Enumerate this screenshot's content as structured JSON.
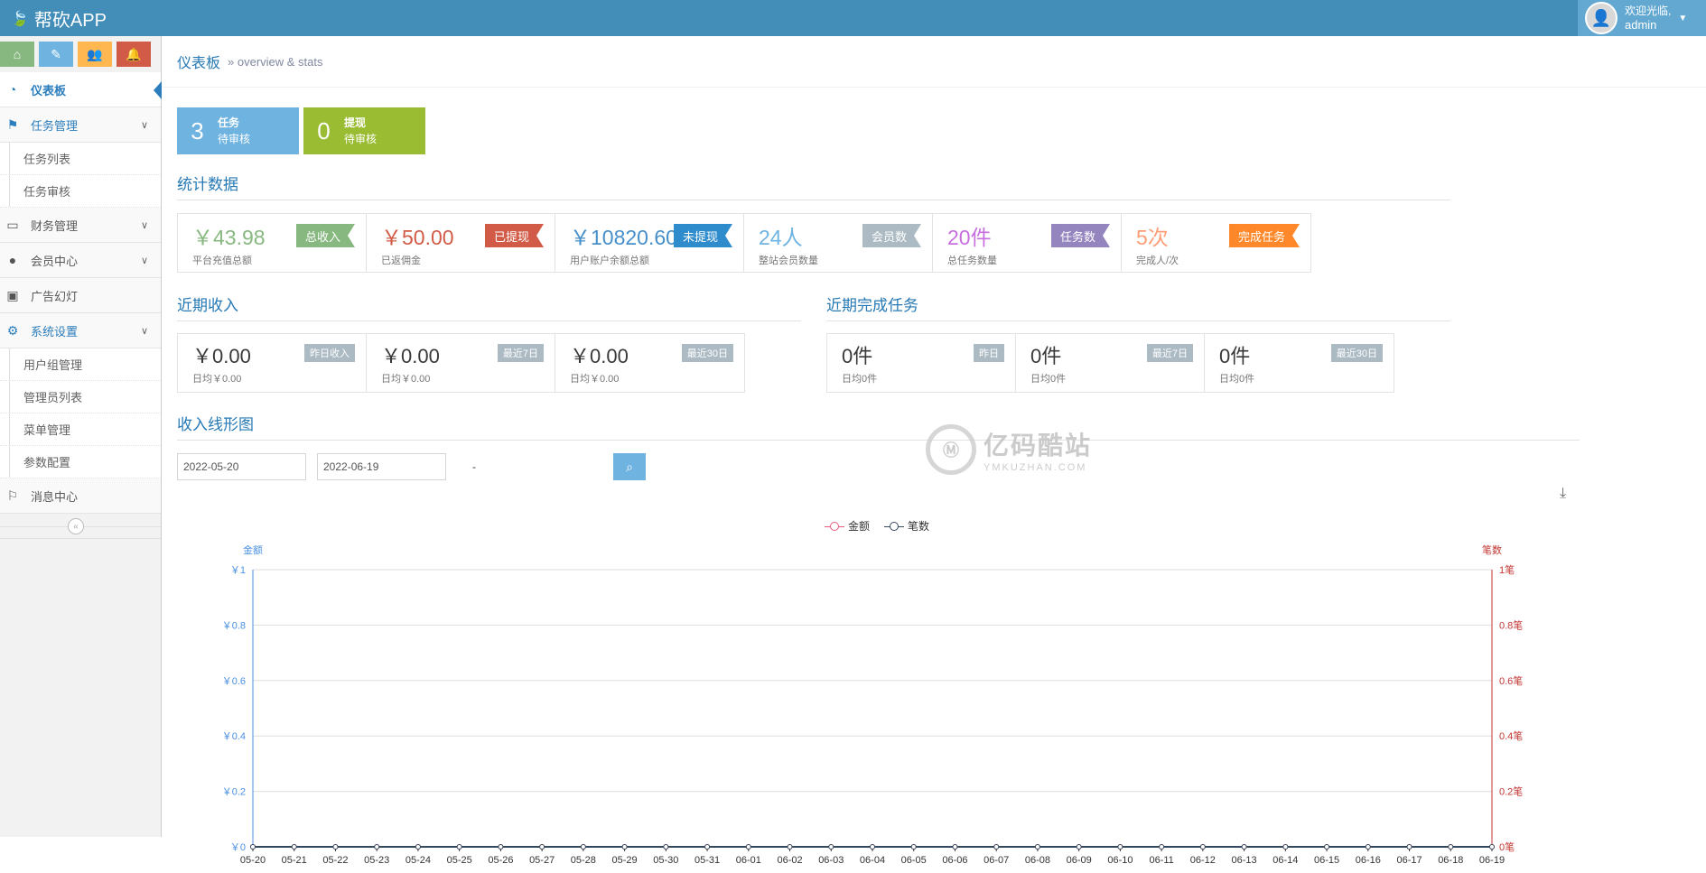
{
  "app": {
    "name": "帮砍APP"
  },
  "user": {
    "greeting": "欢迎光临,",
    "name": "admin"
  },
  "shortcuts": [
    "home-icon",
    "pencil-icon",
    "users-icon",
    "bell-icon"
  ],
  "sidebar": {
    "items": [
      {
        "label": "仪表板",
        "icon": "dashboard-icon"
      },
      {
        "label": "任务管理",
        "icon": "flag-icon"
      },
      {
        "label": "任务列表"
      },
      {
        "label": "任务审核"
      },
      {
        "label": "财务管理",
        "icon": "hdd-icon"
      },
      {
        "label": "会员中心",
        "icon": "user-icon"
      },
      {
        "label": "广告幻灯",
        "icon": "picture-icon"
      },
      {
        "label": "系统设置",
        "icon": "cog-icon"
      },
      {
        "label": "用户组管理"
      },
      {
        "label": "管理员列表"
      },
      {
        "label": "菜单管理"
      },
      {
        "label": "参数配置"
      },
      {
        "label": "消息中心",
        "icon": "bookmark-icon"
      }
    ]
  },
  "breadcrumb": {
    "title": "仪表板",
    "subtitle": "overview & stats"
  },
  "pending": [
    {
      "num": "3",
      "title": "任务",
      "sub": "待审核",
      "color": "#6fb3e0"
    },
    {
      "num": "0",
      "title": "提现",
      "sub": "待审核",
      "color": "#9abc32"
    }
  ],
  "stats_title": "统计数据",
  "stats": [
    {
      "value": "￥43.98",
      "label": "平台充值总额",
      "tag": "总收入",
      "color": "#87b87f",
      "tagColor": "#87b87f"
    },
    {
      "value": "￥50.00",
      "label": "已返佣金",
      "tag": "已提现",
      "color": "#d15b47",
      "tagColor": "#d15b47"
    },
    {
      "value": "￥10820.60",
      "label": "用户账户余额总额",
      "tag": "未提现",
      "color": "#478fca",
      "tagColor": "#2e8bcc"
    },
    {
      "value": "24人",
      "label": "整站会员数量",
      "tag": "会员数",
      "color": "#6fb3e0",
      "tagColor": "#abbac3"
    },
    {
      "value": "20件",
      "label": "总任务数量",
      "tag": "任务数",
      "color": "#c86fe0",
      "tagColor": "#9585bf"
    },
    {
      "value": "5次",
      "label": "完成人/次",
      "tag": "完成任务",
      "color": "#fe9e76",
      "tagColor": "#ff892a"
    }
  ],
  "income_title": "近期收入",
  "income": [
    {
      "value": "￥0.00",
      "sub": "日均￥0.00",
      "tag": "昨日收入"
    },
    {
      "value": "￥0.00",
      "sub": "日均￥0.00",
      "tag": "最近7日"
    },
    {
      "value": "￥0.00",
      "sub": "日均￥0.00",
      "tag": "最近30日"
    }
  ],
  "tasks_title": "近期完成任务",
  "tasks": [
    {
      "value": "0件",
      "sub": "日均0件",
      "tag": "昨日"
    },
    {
      "value": "0件",
      "sub": "日均0件",
      "tag": "最近7日"
    },
    {
      "value": "0件",
      "sub": "日均0件",
      "tag": "最近30日"
    }
  ],
  "chart_section_title": "收入线形图",
  "date_from": "2022-05-20",
  "date_to": "2022-06-19",
  "date_sep": "-",
  "watermark": {
    "main": "亿码酷站",
    "sub": "YMKUZHAN.COM"
  },
  "chart_data": {
    "type": "line",
    "categories": [
      "05-20",
      "05-21",
      "05-22",
      "05-23",
      "05-24",
      "05-25",
      "05-26",
      "05-27",
      "05-28",
      "05-29",
      "05-30",
      "05-31",
      "06-01",
      "06-02",
      "06-03",
      "06-04",
      "06-05",
      "06-06",
      "06-07",
      "06-08",
      "06-09",
      "06-10",
      "06-11",
      "06-12",
      "06-13",
      "06-14",
      "06-15",
      "06-16",
      "06-17",
      "06-18",
      "06-19"
    ],
    "series": [
      {
        "name": "金额",
        "color": "#e75c7c",
        "axis": "left",
        "values": [
          0,
          0,
          0,
          0,
          0,
          0,
          0,
          0,
          0,
          0,
          0,
          0,
          0,
          0,
          0,
          0,
          0,
          0,
          0,
          0,
          0,
          0,
          0,
          0,
          0,
          0,
          0,
          0,
          0,
          0,
          0
        ]
      },
      {
        "name": "笔数",
        "color": "#34495e",
        "axis": "right",
        "values": [
          0,
          0,
          0,
          0,
          0,
          0,
          0,
          0,
          0,
          0,
          0,
          0,
          0,
          0,
          0,
          0,
          0,
          0,
          0,
          0,
          0,
          0,
          0,
          0,
          0,
          0,
          0,
          0,
          0,
          0,
          0
        ]
      }
    ],
    "ylabel_left": "金额",
    "ylabel_right": "笔数",
    "ylim": [
      0,
      1
    ],
    "yticks_left": [
      "￥0",
      "￥0.2",
      "￥0.4",
      "￥0.6",
      "￥0.8",
      "￥1"
    ],
    "yticks_right": [
      "0笔",
      "0.2笔",
      "0.4笔",
      "0.6笔",
      "0.8笔",
      "1笔"
    ],
    "left_axis_color": "#4a90e2",
    "right_axis_color": "#c23531",
    "grid": true,
    "legend": "top-center"
  }
}
